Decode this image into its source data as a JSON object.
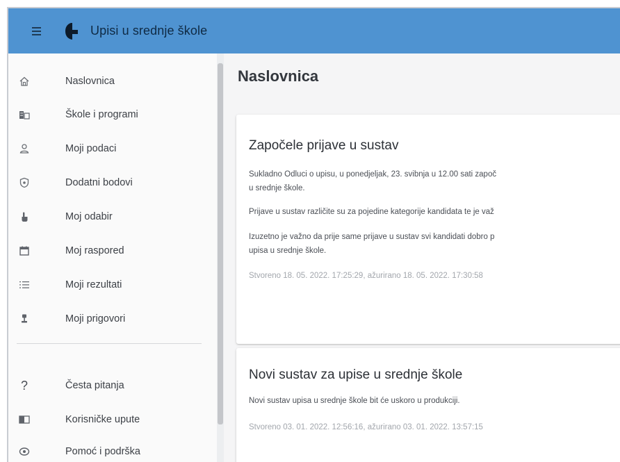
{
  "header": {
    "app_title": "Upisi u srednje škole",
    "menu_icon": "menu-icon",
    "brand_color": "#4f93d1"
  },
  "sidebar": {
    "items": [
      {
        "label": "Naslovnica",
        "icon": "home-icon"
      },
      {
        "label": "Škole i programi",
        "icon": "school-icon"
      },
      {
        "label": "Moji podaci",
        "icon": "person-icon"
      },
      {
        "label": "Dodatni bodovi",
        "icon": "shield-icon"
      },
      {
        "label": "Moj odabir",
        "icon": "hand-point-icon"
      },
      {
        "label": "Moj raspored",
        "icon": "calendar-icon"
      },
      {
        "label": "Moji rezultati",
        "icon": "list-icon"
      },
      {
        "label": "Moji prigovori",
        "icon": "gavel-icon"
      }
    ],
    "secondary_items": [
      {
        "label": "Česta pitanja",
        "icon": "question-icon"
      },
      {
        "label": "Korisničke upute",
        "icon": "book-icon"
      },
      {
        "label": "Pomoć i podrška",
        "icon": "support-icon"
      }
    ]
  },
  "main": {
    "page_title": "Naslovnica",
    "news": [
      {
        "title": "Započele prijave u sustav",
        "paragraphs": [
          "Sukladno Odluci o upisu, u ponedjeljak, 23. svibnja u 12.00 sati započ",
          "u srednje škole.",
          "Prijave u sustav različite su za pojedine kategorije kandidata te je važ",
          "Izuzetno je važno da prije same prijave u sustav svi kandidati dobro p",
          "upisa u srednje škole."
        ],
        "meta": "Stvoreno 18. 05. 2022. 17:25:29, ažurirano 18. 05. 2022. 17:30:58"
      },
      {
        "title": "Novi sustav za upise u srednje škole",
        "paragraphs": [
          "Novi sustav upisa u srednje škole bit će uskoro u produkciji."
        ],
        "meta": "Stvoreno 03. 01. 2022. 12:56:16, ažurirano 03. 01. 2022. 13:57:15"
      }
    ]
  }
}
